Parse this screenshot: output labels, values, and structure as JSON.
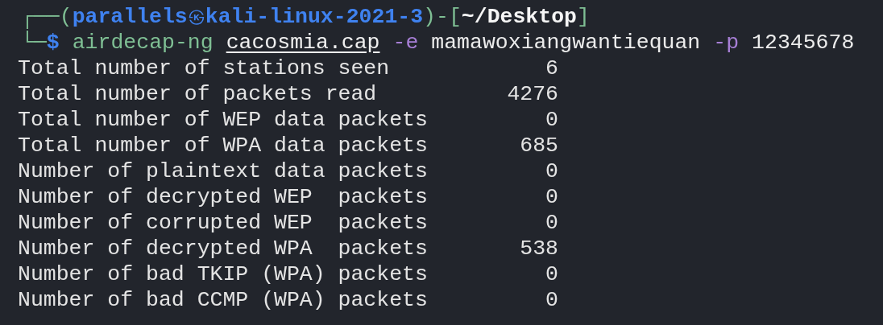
{
  "prompt": {
    "corner_top": "┌──(",
    "user": "parallels",
    "separator": "㉿",
    "host": "kali-linux-2021-3",
    "mid": ")-[",
    "path": "~/Desktop",
    "end": "]",
    "corner_bottom": "└─",
    "symbol": "$"
  },
  "command": [
    {
      "kind": "program",
      "text": "airdecap-ng"
    },
    {
      "kind": "file",
      "text": "cacosmia.cap"
    },
    {
      "kind": "flag",
      "text": "-e"
    },
    {
      "kind": "arg",
      "text": "mamawoxiangwantiequan"
    },
    {
      "kind": "flag",
      "text": "-p"
    },
    {
      "kind": "arg",
      "text": "12345678"
    }
  ],
  "output": [
    {
      "label": "Total number of stations seen",
      "value": "6"
    },
    {
      "label": "Total number of packets read",
      "value": "4276"
    },
    {
      "label": "Total number of WEP data packets",
      "value": "0"
    },
    {
      "label": "Total number of WPA data packets",
      "value": "685"
    },
    {
      "label": "Number of plaintext data packets",
      "value": "0"
    },
    {
      "label": "Number of decrypted WEP  packets",
      "value": "0"
    },
    {
      "label": "Number of corrupted WEP  packets",
      "value": "0"
    },
    {
      "label": "Number of decrypted WPA  packets",
      "value": "538"
    },
    {
      "label": "Number of bad TKIP (WPA) packets",
      "value": "0"
    },
    {
      "label": "Number of bad CCMP (WPA) packets",
      "value": "0"
    }
  ]
}
